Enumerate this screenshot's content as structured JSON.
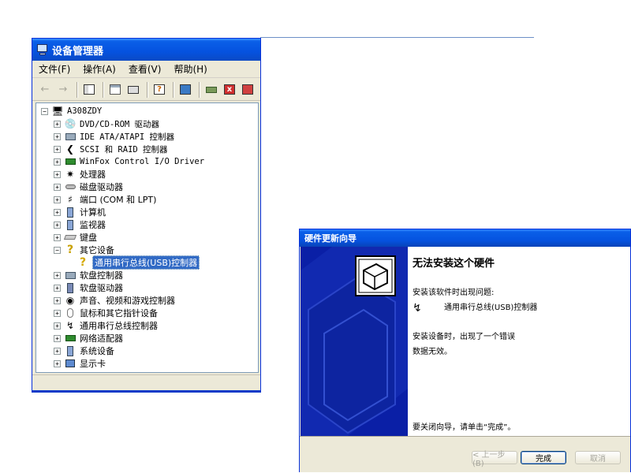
{
  "device_manager": {
    "title": "设备管理器",
    "menu": [
      "文件(F)",
      "操作(A)",
      "查看(V)",
      "帮助(H)"
    ],
    "toolbar_icons": [
      "back-arrow-icon",
      "forward-arrow-icon",
      "console-tree-icon",
      "properties-icon",
      "print-icon",
      "help-icon",
      "scan-hardware-icon",
      "update-driver-icon",
      "disable-device-icon",
      "uninstall-device-icon"
    ],
    "tree": {
      "root": "A308ZDY",
      "items": [
        {
          "label": "DVD/CD-ROM 驱动器",
          "icon": "cdrom-icon",
          "expanded": false
        },
        {
          "label": "IDE ATA/ATAPI 控制器",
          "icon": "ide-controller-icon",
          "expanded": false
        },
        {
          "label": "SCSI 和 RAID 控制器",
          "icon": "scsi-controller-icon",
          "expanded": false
        },
        {
          "label": "WinFox Control I/O Driver",
          "icon": "chip-icon",
          "expanded": false
        },
        {
          "label": "处理器",
          "icon": "processor-icon",
          "expanded": false
        },
        {
          "label": "磁盘驱动器",
          "icon": "disk-drive-icon",
          "expanded": false
        },
        {
          "label": "端口 (COM 和 LPT)",
          "icon": "port-icon",
          "expanded": false
        },
        {
          "label": "计算机",
          "icon": "computer-icon",
          "expanded": false
        },
        {
          "label": "监视器",
          "icon": "monitor-icon",
          "expanded": false
        },
        {
          "label": "键盘",
          "icon": "keyboard-icon",
          "expanded": false
        },
        {
          "label": "其它设备",
          "icon": "unknown-device-icon",
          "expanded": true
        },
        {
          "label": "通用串行总线(USB)控制器",
          "icon": "unknown-device-warning-icon",
          "child": true,
          "selected": true
        },
        {
          "label": "软盘控制器",
          "icon": "floppy-controller-icon",
          "expanded": false
        },
        {
          "label": "软盘驱动器",
          "icon": "floppy-drive-icon",
          "expanded": false
        },
        {
          "label": "声音、视频和游戏控制器",
          "icon": "sound-icon",
          "expanded": false
        },
        {
          "label": "鼠标和其它指针设备",
          "icon": "mouse-icon",
          "expanded": false
        },
        {
          "label": "通用串行总线控制器",
          "icon": "usb-icon",
          "expanded": false
        },
        {
          "label": "网络适配器",
          "icon": "network-adapter-icon",
          "expanded": false
        },
        {
          "label": "系统设备",
          "icon": "system-device-icon",
          "expanded": false
        },
        {
          "label": "显示卡",
          "icon": "display-adapter-icon",
          "expanded": false
        }
      ]
    }
  },
  "wizard": {
    "title": "硬件更新向导",
    "heading": "无法安装这个硬件",
    "problem_intro": "安装该软件时出现问题:",
    "device_name": "通用串行总线(USB)控制器",
    "error_line1": "安装设备时，出现了一个错误",
    "error_line2": "数据无效。",
    "close_hint": "要关闭向导，请单击“完成”。",
    "buttons": {
      "back": "< 上一步(B)",
      "finish": "完成",
      "cancel": "取消"
    },
    "colors": {
      "sidebar": "#0a1fa6"
    }
  }
}
